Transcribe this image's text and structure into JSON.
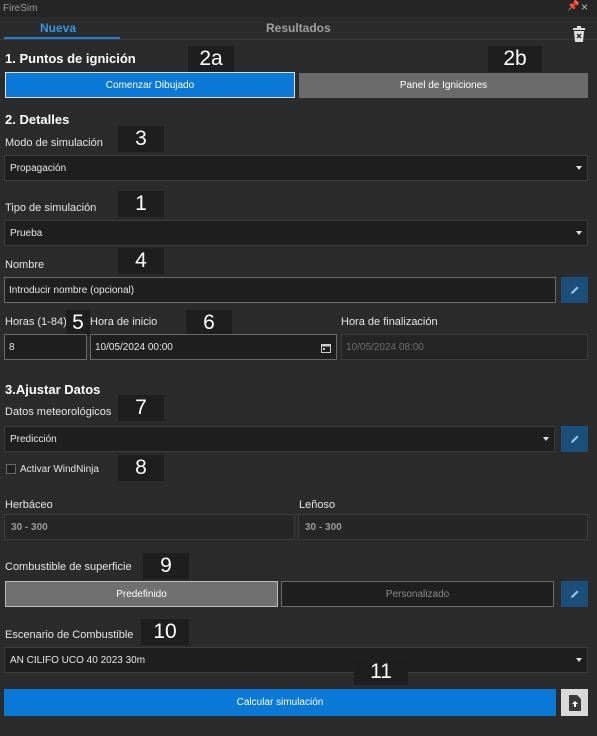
{
  "app": {
    "title": "FireSim",
    "pin_glyph": "📌",
    "close_glyph": "×"
  },
  "tabs": [
    {
      "label": "Nueva",
      "active": true
    },
    {
      "label": "Resultados",
      "active": false
    }
  ],
  "ignition": {
    "heading": "1. Puntos de ignición",
    "start_drawing_label": "Comenzar Dibujado",
    "panel_label": "Panel de Igniciones"
  },
  "details": {
    "heading": "2. Detalles",
    "mode_label": "Modo de simulación",
    "mode_value": "Propagación",
    "type_label": "Tipo de simulación",
    "type_value": "Prueba",
    "name_label": "Nombre",
    "name_placeholder": "Introducir nombre (opcional)",
    "hours_label": "Horas (1-84)",
    "hours_value": "8",
    "start_label": "Hora de inicio",
    "start_value": "10/05/2024 00:00",
    "end_label": "Hora de finalización",
    "end_value": "10/05/2024 08:00"
  },
  "adjust": {
    "heading": "3.Ajustar Datos",
    "weather_label": "Datos meteorológicos",
    "weather_value": "Predicción",
    "windninja_label": "Activar WindNinja",
    "windninja_checked": false,
    "herb_label": "Herbáceo",
    "herb_value": "30 - 300",
    "woody_label": "Leñoso",
    "woody_value": "30 - 300",
    "surface_label": "Combustible de superficie",
    "surface_options": [
      "Predefinido",
      "Personalizado"
    ],
    "surface_selected": "Predefinido",
    "scenario_label": "Escenario de Combustible",
    "scenario_value": "AN CILIFO UCO 40 2023 30m"
  },
  "actions": {
    "calculate_label": "Calcular simulación"
  },
  "annotations": [
    "2a",
    "2b",
    "3",
    "1",
    "4",
    "5",
    "6",
    "7",
    "8",
    "9",
    "10",
    "11"
  ],
  "colors": {
    "accent": "#0a78d7",
    "tab_active": "#2f9be6",
    "background": "#2b2b2b",
    "pencil_button": "#1a4f7a"
  },
  "icons": [
    "trash-icon",
    "pin-icon",
    "close-icon",
    "pencil-icon",
    "calendar-icon",
    "export-icon",
    "chevron-down-icon"
  ]
}
